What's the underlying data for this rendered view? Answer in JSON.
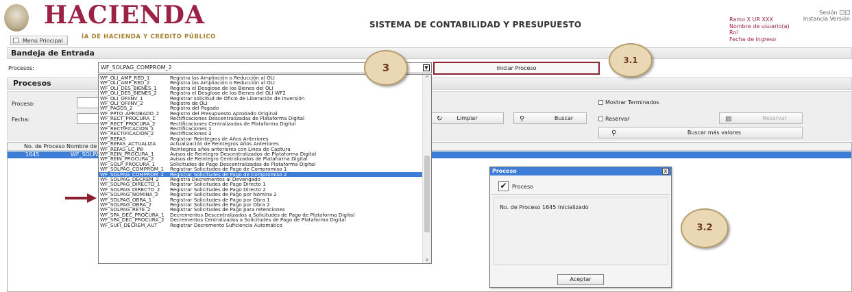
{
  "header": {
    "logo_text": "HACIENDA",
    "logo_subtitle": "ÍA DE HACIENDA Y CRÉDITO PÚBLICO",
    "menu_label": "Menú Principal",
    "system_title": "SISTEMA DE CONTABILIDAD Y PRESUPUESTO",
    "user": {
      "ramo": "Ramo X UR XXX",
      "nombre": "Nombre de usuario(a)",
      "rol": "Rol",
      "fecha": "Fecha de ingreso"
    },
    "session_label": "Sesión",
    "instancia_label": "Instancia",
    "version_label": "Versión"
  },
  "bandeja": {
    "title": "Bandeja de Entrada",
    "procesos_label": "Procesos:",
    "selected_process": "WF_SOLPAG_COMPROM_2",
    "iniciar_label": "Iniciar Proceso"
  },
  "procesos_section": {
    "title": "Procesos",
    "proceso_label": "Proceso:",
    "fecha_label": "Fecha:",
    "limpiar_label": "Limpiar",
    "buscar_label": "Buscar",
    "mostrar_terminados_label": "Mostrar Terminados",
    "reservar_check_label": "Reservar",
    "reservar_button_label": "Reservar",
    "buscar_mas_label": "Buscar más valores"
  },
  "grid": {
    "headers": [
      "No. de Proceso",
      "Nombre de"
    ],
    "row": {
      "numero": "1645",
      "nombre": "WF_SOLPA"
    }
  },
  "dropdown": {
    "items": [
      {
        "code": "WF_OLI_AMP_RED_1",
        "desc": "Registra las Ampliación o Reducción al OLI"
      },
      {
        "code": "WF_OLI_AMP_RED_2",
        "desc": "Registra las Ampliación o Reducción al OLI"
      },
      {
        "code": "WF_OLI_DES_BIENES_1",
        "desc": "Registra el Desglose de los Bienes del OLI"
      },
      {
        "code": "WF_OLI_DES_BIENES_2",
        "desc": "Registra el Desglose de los Bienes del OLI WF2"
      },
      {
        "code": "WF_OLI_OFIINV_1",
        "desc": "Registrar solicitud de Oficio de Liberación de Inversión"
      },
      {
        "code": "WF_OLI_OFIINV_2",
        "desc": "Registro de OLI"
      },
      {
        "code": "WF_PAGOS_2",
        "desc": "Registro del Pagado"
      },
      {
        "code": "WF_PPTO_APROBADO_2",
        "desc": "Registro del Presupuesto Aprobado Original"
      },
      {
        "code": "WF_RECT_PROCURA_1",
        "desc": "Rectificaciones Descentralizadas de Plataforma Digital"
      },
      {
        "code": "WF_RECT_PROCURA_2",
        "desc": "Rectificaciones Centralizadas de Plataforma Digital"
      },
      {
        "code": "WF_RECTIFICACION_1",
        "desc": "Rectificaciones 1"
      },
      {
        "code": "WF_RECTIFICACION_2",
        "desc": "Rectificaciones 2"
      },
      {
        "code": "WF_REFAS",
        "desc": "Registrar Reintegros de Años Anteriores"
      },
      {
        "code": "WF_REFAS_ACTUALIZA",
        "desc": "Actualización de Reintegros Años Anteriores"
      },
      {
        "code": "WF_REFAS_LC_INI",
        "desc": "Reintegros años anteriores con Línea de Captura"
      },
      {
        "code": "WF_REIN_PROCURA_1",
        "desc": "Avisos de Reintegro Descentralizados de Plataforma Digital"
      },
      {
        "code": "WF_REIN_PROCURA_2",
        "desc": "Avisos de Reintegro Centralizados de Plataforma Digital"
      },
      {
        "code": "WF_SOLP_PROCURA_1",
        "desc": "Solicitudes de Pago Descentralizadas de Plataforma Digital"
      },
      {
        "code": "WF_SOLPAG_COMPROM_1",
        "desc": "Registrar Solicitudes de Pago de Compromiso 1"
      },
      {
        "code": "WF_SOLPAG_COMPROM_2",
        "desc": "Registrar Solicitudes de Pago de Compromiso 2"
      },
      {
        "code": "WF_SOLPAG_DECREM_2",
        "desc": "Registra Decrementos al Devengado"
      },
      {
        "code": "WF_SOLPAG_DIRECTO_1",
        "desc": "Registrar Solicitudes de Pago Directo 1"
      },
      {
        "code": "WF_SOLPAG_DIRECTO_2",
        "desc": "Registrar Solicitudes de Pago Directo 2"
      },
      {
        "code": "WF_SOLPAG_NOMINA_2",
        "desc": "Registrar Solicitudes de Pago por Nómina 2"
      },
      {
        "code": "WF_SOLPAG_OBRA_1",
        "desc": "Registrar Solicitudes de Pago por Obra 1"
      },
      {
        "code": "WF_SOLPAG_OBRA_2",
        "desc": "Registrar Solicitudes de Pago por Obra 2"
      },
      {
        "code": "WF_SOLPAG_RETE_2",
        "desc": "Registrar Solicitudes de Pago para retenciones"
      },
      {
        "code": "WF_SPA_DEC_PROCURA_1",
        "desc": "Decrementos Descentralizados a Solicitudes de Pago de Plataforma Digital"
      },
      {
        "code": "WF_SPA_DEC_PROCURA_2",
        "desc": "Decrementos Centralizados a Solicitudes de Pago de Plataforma Digital"
      },
      {
        "code": "WF_SUFI_DECREM_AUT",
        "desc": "Registrar Decremento Suficiencia Automático"
      }
    ],
    "selected_index": 19
  },
  "steps": {
    "step_3": "3",
    "step_3_1": "3.1",
    "step_3_2": "3.2"
  },
  "modal": {
    "title": "Proceso",
    "close_glyph": "x",
    "head_label": "Proceso",
    "message": "No. de Proceso 1645 Inicializado",
    "ok_label": "Aceptar"
  },
  "colors": {
    "brand": "#9b2247",
    "gold": "#a57f2c",
    "selection": "#3d7dd8",
    "step_fill": "#e9d8b3"
  }
}
